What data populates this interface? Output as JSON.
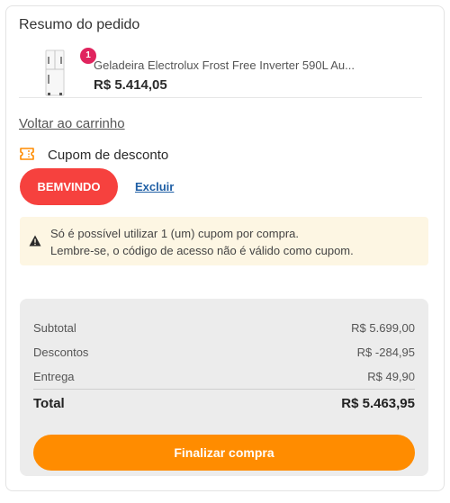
{
  "summary_title": "Resumo do pedido",
  "product": {
    "quantity": "1",
    "name": "Geladeira Electrolux Frost Free Inverter 590L Au...",
    "price": "R$ 5.414,05",
    "image_icon": "refrigerator-image"
  },
  "back_link": "Voltar ao carrinho",
  "coupon": {
    "title": "Cupom de desconto",
    "icon": "ticket-icon",
    "applied_code": "BEMVINDO",
    "remove_label": "Excluir"
  },
  "notice": {
    "icon": "warning-icon",
    "line1": "Só é possível utilizar 1 (um) cupom por compra.",
    "line2": "Lembre-se, o código de acesso não é válido como cupom."
  },
  "totals": {
    "subtotal_label": "Subtotal",
    "subtotal_value": "R$ 5.699,00",
    "discount_label": "Descontos",
    "discount_value": "R$ -284,95",
    "shipping_label": "Entrega",
    "shipping_value": "R$ 49,90",
    "total_label": "Total",
    "total_value": "R$ 5.463,95"
  },
  "checkout_label": "Finalizar compra",
  "colors": {
    "coupon_button": "#f6413e",
    "checkout_button": "#ff8c00",
    "badge": "#e0245e",
    "link": "#1f5fa5",
    "notice_bg": "#fdf6e3"
  }
}
